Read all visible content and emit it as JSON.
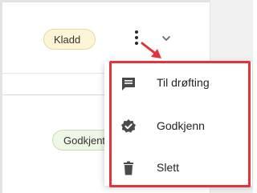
{
  "rows": [
    {
      "status_label": "Kladd"
    },
    {
      "status_label": "Godkjent"
    }
  ],
  "menu": {
    "items": [
      {
        "label": "Til drøfting",
        "icon": "comment-icon"
      },
      {
        "label": "Godkjenn",
        "icon": "verified-badge-icon"
      },
      {
        "label": "Slett",
        "icon": "trash-icon"
      }
    ]
  },
  "colors": {
    "highlight": "#e3343c",
    "draft_badge_bg": "#fdf5d5",
    "approved_badge_bg": "#eef6e6",
    "icon": "#4a4a4a"
  }
}
